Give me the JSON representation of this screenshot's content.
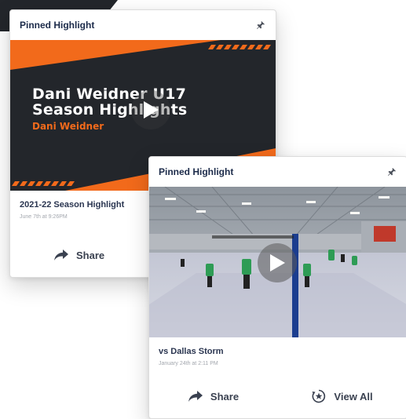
{
  "cards": [
    {
      "header": "Pinned Highlight",
      "thumbnail": {
        "line1": "Dani Weidner U17",
        "line2": "Season Highlights",
        "line3": "Dani Weidner"
      },
      "title": "2021-22 Season Highlight",
      "date": "June 7th at 9:26PM",
      "actions": {
        "share": "Share"
      }
    },
    {
      "header": "Pinned Highlight",
      "title": "vs Dallas Storm",
      "date": "January 24th at 2:11 PM",
      "actions": {
        "share": "Share",
        "view_all": "View All"
      }
    }
  ],
  "colors": {
    "accent_orange": "#f26a1b",
    "dark": "#23262b",
    "title_navy": "#1c2b4a"
  }
}
